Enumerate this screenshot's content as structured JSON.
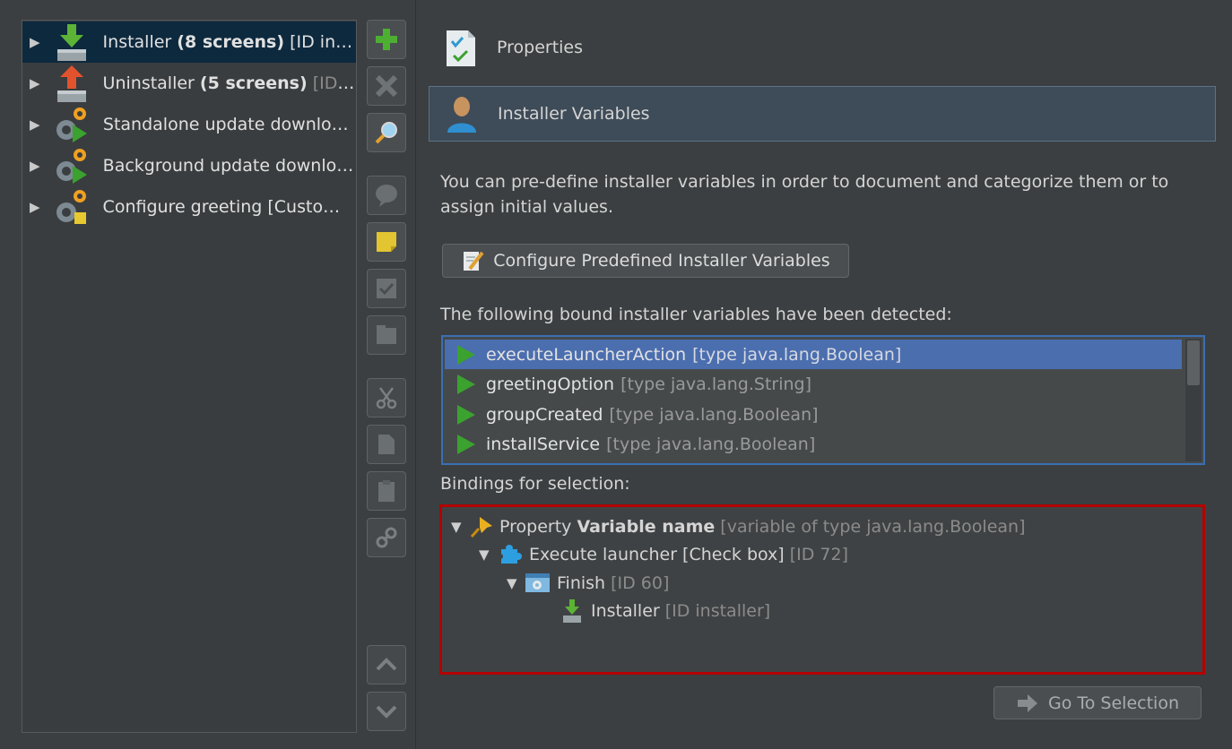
{
  "tree": {
    "items": [
      {
        "name": "Installer",
        "bold": "(8 screens)",
        "dim": "[ID instal...",
        "selected": true
      },
      {
        "name": "Uninstaller",
        "bold": "(5 screens)",
        "dim": "[ID un...",
        "selected": false
      },
      {
        "name": "Standalone update downloa...",
        "bold": "",
        "dim": "",
        "selected": false
      },
      {
        "name": "Background update downloa...",
        "bold": "",
        "dim": "",
        "selected": false
      },
      {
        "name": "Configure greeting [Custom a...",
        "bold": "",
        "dim": "",
        "selected": false
      }
    ]
  },
  "sections": {
    "properties": "Properties",
    "installer_variables": "Installer Variables"
  },
  "description": "You can pre-define installer variables in order to document and categorize them or to assign initial values.",
  "configure_button": "Configure Predefined Installer Variables",
  "bound_label": "The following bound installer variables have been detected:",
  "bound_variables": [
    {
      "name": "executeLauncherAction",
      "type": "[type java.lang.Boolean]"
    },
    {
      "name": "greetingOption",
      "type": "[type java.lang.String]"
    },
    {
      "name": "groupCreated",
      "type": "[type java.lang.Boolean]"
    },
    {
      "name": "installService",
      "type": "[type java.lang.Boolean]"
    }
  ],
  "bindings_label": "Bindings for selection:",
  "bindings": {
    "property": {
      "prefix": "Property ",
      "bold": "Variable name",
      "dim": "[variable of type java.lang.Boolean]"
    },
    "launcher": {
      "name": "Execute launcher [Check box]",
      "dim": "[ID 72]"
    },
    "finish": {
      "name": "Finish",
      "dim": "[ID 60]"
    },
    "installer": {
      "name": "Installer",
      "dim": "[ID installer]"
    }
  },
  "go_to_selection": "Go To Selection",
  "colors": {
    "accent_selected": "#4b6eaf",
    "highlight_border": "#b40000",
    "play_green": "#3ba12f"
  }
}
